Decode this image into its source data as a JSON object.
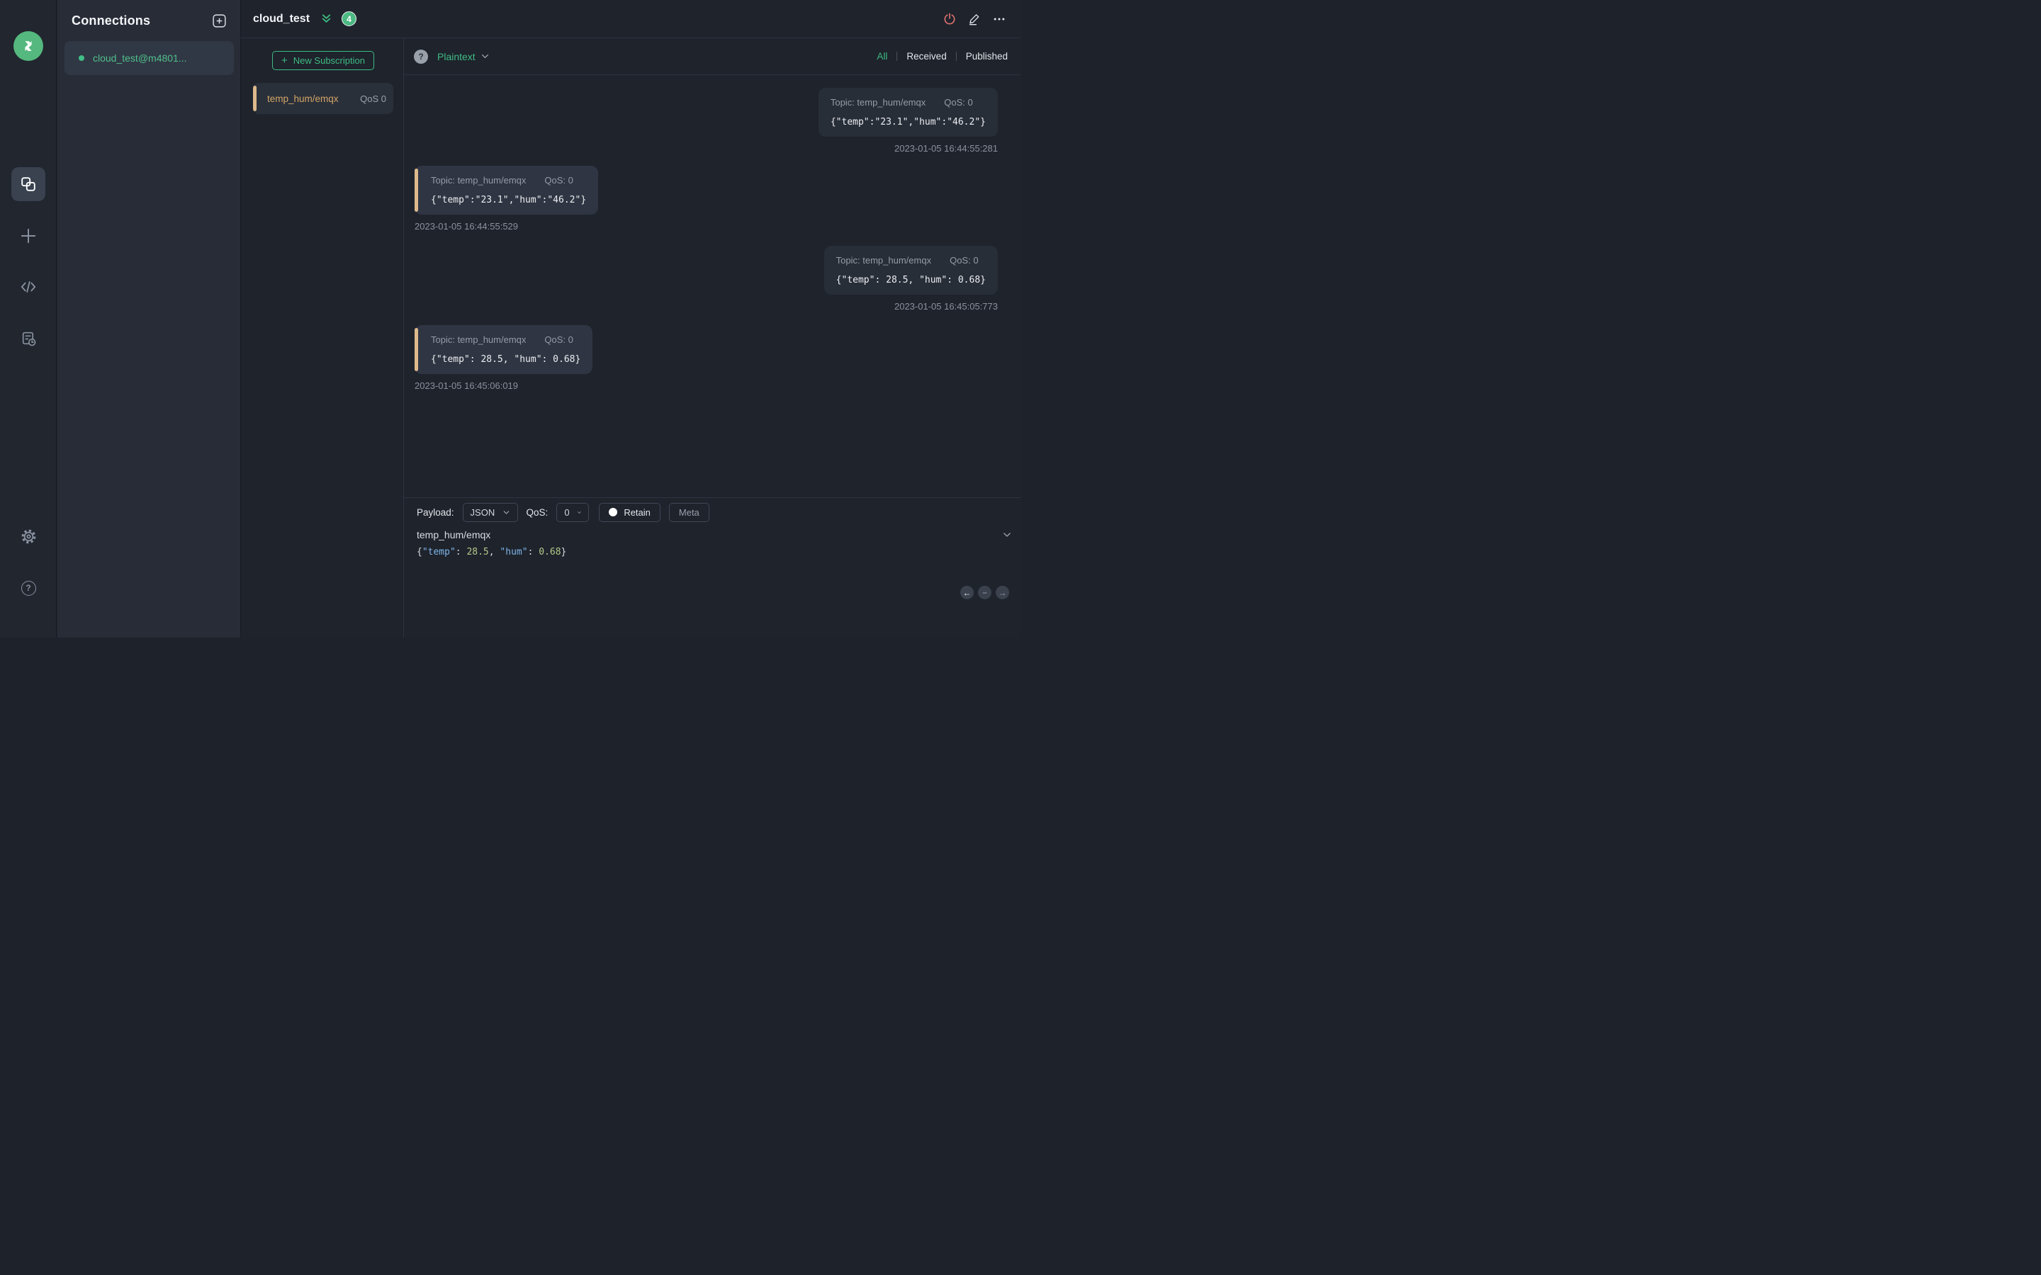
{
  "colors": {
    "accent_green": "#3fbb82",
    "accent_orange": "#ddb98c",
    "power_red": "#e57470",
    "badge_green": "#4cb882"
  },
  "glyphs": {
    "question": "?",
    "plus": "+",
    "back_arrow": "←",
    "minus": "−",
    "forward_arrow": "→"
  },
  "sidebar": {
    "icons": [
      "mqttx-logo",
      "connections",
      "new-connection",
      "script",
      "log",
      "settings",
      "help"
    ]
  },
  "connections_panel": {
    "title": "Connections",
    "items": [
      {
        "name": "cloud_test@m4801...",
        "status": "connected"
      }
    ]
  },
  "header": {
    "title": "cloud_test",
    "unread_count": "4",
    "actions": [
      "disconnect",
      "edit",
      "more"
    ]
  },
  "subscriptions": {
    "new_button_label": "New Subscription",
    "items": [
      {
        "topic": "temp_hum/emqx",
        "qos": "QoS 0"
      }
    ]
  },
  "messages_panel": {
    "format_selected": "Plaintext",
    "filters": {
      "options": [
        "All",
        "Received",
        "Published"
      ],
      "active": "All"
    },
    "messages": [
      {
        "direction": "published",
        "topic_label": "Topic: temp_hum/emqx",
        "qos_label": "QoS: 0",
        "payload": "{\"temp\":\"23.1\",\"hum\":\"46.2\"}",
        "timestamp": "2023-01-05 16:44:55:281"
      },
      {
        "direction": "received",
        "topic_label": "Topic: temp_hum/emqx",
        "qos_label": "QoS: 0",
        "payload": "{\"temp\":\"23.1\",\"hum\":\"46.2\"}",
        "timestamp": "2023-01-05 16:44:55:529"
      },
      {
        "direction": "published",
        "topic_label": "Topic: temp_hum/emqx",
        "qos_label": "QoS: 0",
        "payload": "{\"temp\": 28.5, \"hum\": 0.68}",
        "timestamp": "2023-01-05 16:45:05:773"
      },
      {
        "direction": "received",
        "topic_label": "Topic: temp_hum/emqx",
        "qos_label": "QoS: 0",
        "payload": "{\"temp\": 28.5, \"hum\": 0.68}",
        "timestamp": "2023-01-05 16:45:06:019"
      }
    ]
  },
  "publish_panel": {
    "payload_label": "Payload:",
    "format_value": "JSON",
    "qos_label": "QoS:",
    "qos_value": "0",
    "retain_label": "Retain",
    "meta_label": "Meta",
    "topic_value": "temp_hum/emqx",
    "payload_value": "{\"temp\": 28.5, \"hum\": 0.68}",
    "payload_tokens": [
      {
        "text": "{",
        "type": "punct"
      },
      {
        "text": "\"temp\"",
        "type": "key"
      },
      {
        "text": ": ",
        "type": "punct"
      },
      {
        "text": "28.5",
        "type": "number"
      },
      {
        "text": ", ",
        "type": "punct"
      },
      {
        "text": "\"hum\"",
        "type": "key"
      },
      {
        "text": ": ",
        "type": "punct"
      },
      {
        "text": "0.68",
        "type": "number"
      },
      {
        "text": "}",
        "type": "punct"
      }
    ]
  }
}
